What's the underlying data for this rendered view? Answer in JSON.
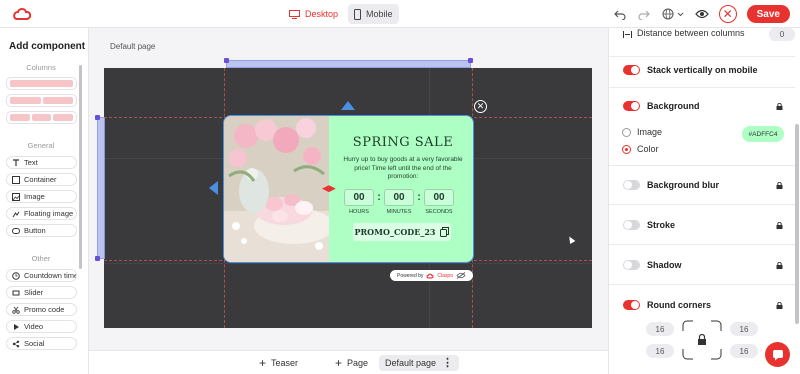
{
  "topbar": {
    "devices": [
      {
        "label": "Desktop",
        "active": true,
        "icon": "monitor-icon"
      },
      {
        "label": "Mobile",
        "active": false,
        "icon": "phone-icon"
      }
    ],
    "save_label": "Save"
  },
  "left_panel": {
    "title": "Add component",
    "sections": {
      "columns": "Columns",
      "general": "General",
      "other": "Other"
    },
    "general_items": [
      "Text",
      "Container",
      "Image",
      "Floating image",
      "Button"
    ],
    "other_items": [
      "Countdown timer",
      "Slider",
      "Promo code",
      "Video",
      "Social"
    ]
  },
  "canvas": {
    "page_label": "Default page"
  },
  "popup": {
    "title": "SPRING SALE",
    "subtitle": "Hurry up to buy goods at a very favorable price! Time left until the end of the promotion:",
    "timer": {
      "hours": "00",
      "minutes": "00",
      "seconds": "00",
      "hours_label": "HOURS",
      "minutes_label": "MINUTES",
      "seconds_label": "SECONDS",
      "separator": ":"
    },
    "promo_code": "PROMO_CODE_23",
    "powered_by": "Powered by",
    "brand": "Claspo",
    "background_color": "#ADFFC4"
  },
  "bottom_bar": {
    "teaser": "Teaser",
    "page": "Page",
    "current_page": "Default page"
  },
  "right_panel": {
    "distance_label": "Distance between columns",
    "distance_value": "0",
    "stack_label": "Stack vertically on mobile",
    "background_label": "Background",
    "image_option": "Image",
    "color_option": "Color",
    "color_value": "#ADFFC4",
    "blur_label": "Background blur",
    "stroke_label": "Stroke",
    "shadow_label": "Shadow",
    "corners_label": "Round corners",
    "corner_values": [
      "16",
      "16",
      "16",
      "16"
    ]
  },
  "colors": {
    "accent": "#e8322f",
    "popup_bg": "#adffc4",
    "canvas_bg": "#3a3a3c"
  }
}
